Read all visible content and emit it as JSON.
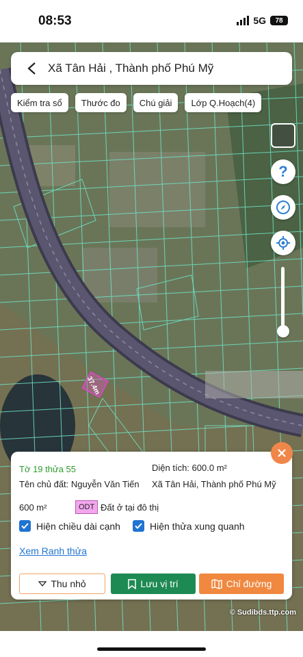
{
  "status_bar": {
    "time": "08:53",
    "network": "5G",
    "battery": "78"
  },
  "search": {
    "title": "Xã Tân Hải , Thành phố Phú Mỹ"
  },
  "chips": [
    "Kiểm tra sổ",
    "Thước đo",
    "Chú giải",
    "Lớp Q.Hoạch(4)"
  ],
  "tools": {
    "help_label": "?"
  },
  "map": {
    "plot_length_label": "37.4m",
    "copyright": "© Sudibds.ttp.com"
  },
  "parcel": {
    "parcel_id": "Tờ 19 thửa 55",
    "area_label": "Diện tích:",
    "area_value": "600.0 m²",
    "owner_label": "Tên chủ đất:",
    "owner_name": "Nguyễn Văn Tiến",
    "location": "Xã Tân Hải, Thành phố Phú Mỹ",
    "land_size": "600 m²",
    "zone_code": "ODT",
    "zone_desc": "Đất ở tại đô thị",
    "show_edge_length_label": "Hiện chiều dài cạnh",
    "show_edge_length_checked": true,
    "show_surrounding_label": "Hiện thửa xung quanh",
    "show_surrounding_checked": true,
    "view_boundary_link": "Xem Ranh thửa",
    "shrink_button": "Thu nhỏ",
    "save_location_button": "Lưu vị trí",
    "directions_button": "Chỉ đường"
  },
  "colors": {
    "parcel_lines": "#6fe6c8",
    "highway": "#4e4a63",
    "accent_orange": "#f0883f",
    "save_green": "#1e8a53",
    "link_blue": "#1f73d1"
  }
}
